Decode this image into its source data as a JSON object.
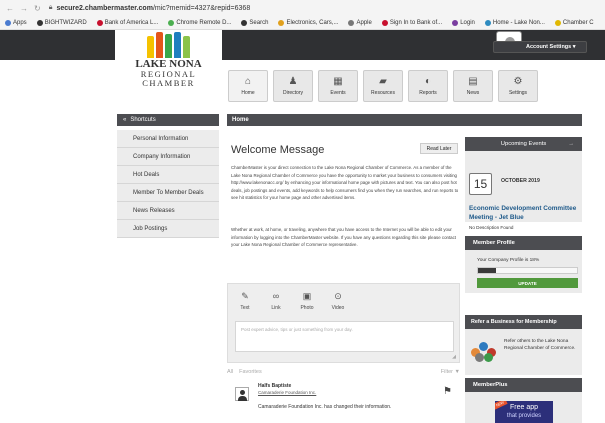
{
  "browser": {
    "url_prefix": "secure2.chambermaster.com",
    "url_path": "/mic?memid=4327&repid=6368"
  },
  "bookmarks": [
    {
      "label": "Apps",
      "color": "#4a7bd0"
    },
    {
      "label": "BIGHTWIZARD",
      "color": "#333333"
    },
    {
      "label": "Bank of America L...",
      "color": "#c8102e"
    },
    {
      "label": "Chrome Remote D...",
      "color": "#4caf50"
    },
    {
      "label": "Search",
      "color": "#333333"
    },
    {
      "label": "Electronics, Cars,...",
      "color": "#e1a01c"
    },
    {
      "label": "Apple",
      "color": "#777777"
    },
    {
      "label": "Sign In to Bank of...",
      "color": "#c8102e"
    },
    {
      "label": "Login",
      "color": "#7a3ea0"
    },
    {
      "label": "Home - Lake Non...",
      "color": "#2e8bc0"
    },
    {
      "label": "Chamber C",
      "color": "#e1b800"
    }
  ],
  "logo": {
    "line1": "LAKE NONA",
    "line2": "REGIONAL",
    "line3": "CHAMBER"
  },
  "account": {
    "label": "Account Settings ▾"
  },
  "nav": [
    {
      "label": "Home",
      "icon": "home-icon",
      "glyph": "⌂"
    },
    {
      "label": "Directory",
      "icon": "directory-icon",
      "glyph": "♟"
    },
    {
      "label": "Events",
      "icon": "calendar-icon",
      "glyph": "▦"
    },
    {
      "label": "Resources",
      "icon": "folder-icon",
      "glyph": "▰"
    },
    {
      "label": "Reports",
      "icon": "reports-icon",
      "glyph": "◐"
    },
    {
      "label": "News",
      "icon": "news-icon",
      "glyph": "▤"
    },
    {
      "label": "Settings",
      "icon": "gear-icon",
      "glyph": "⚙"
    }
  ],
  "shortcuts": {
    "title": "Shortcuts",
    "items": [
      "Personal Information",
      "Company Information",
      "Hot Deals",
      "Member To Member Deals",
      "News Releases",
      "Job Postings"
    ]
  },
  "home": {
    "title": "Home"
  },
  "welcome": {
    "title": "Welcome Message",
    "read_later": "Read Later",
    "p1": "ChamberMaster is your direct connection to the Lake Nona Regional Chamber of Commerce. As a member of the Lake Nona Regional Chamber of Commerce you have the opportunity to market your business to consumers visiting http://www.lakenonacc.org/ by enhancing your informational home page with pictures and text. You can also post hot deals, job postings and events, add keywords to help consumers find you when they run searches, and run reports to see hit statistics for your home page and other advertised items.",
    "p2": "Whether at work, at home, or traveling, anywhere that you have access to the Internet you will be able to edit your information by logging into the ChamberMaster website. If you have any questions regarding this site please contact your Lake Nona Regional Chamber of Commerce representative."
  },
  "post": {
    "options": [
      {
        "label": "Text",
        "icon": "pencil-icon",
        "glyph": "✎"
      },
      {
        "label": "Link",
        "icon": "link-icon",
        "glyph": "∞"
      },
      {
        "label": "Photo",
        "icon": "photo-icon",
        "glyph": "▣"
      },
      {
        "label": "Video",
        "icon": "video-icon",
        "glyph": "⊙"
      }
    ],
    "placeholder": "Post expert advice, tips or just something from your day."
  },
  "feed_tabs": {
    "all": "All",
    "favorites": "Favorites",
    "filter": "Filter ▼"
  },
  "feed": {
    "name": "Halfs Baptiste",
    "org": "Camaraderie Foundation Inc.",
    "message": "Camaraderie Foundation Inc. has changed their information."
  },
  "upcoming": {
    "title": "Upcoming Events",
    "arrow": "→",
    "day": "15",
    "month": "OCTOBER 2019",
    "event": "Economic Development Committee Meeting - Jet Blue",
    "desc": "No Description Found"
  },
  "profile": {
    "title": "Member Profile",
    "pct_label": "Your Company Profile is 18%",
    "pct": 0.18,
    "update": "UPDATE"
  },
  "referral": {
    "title": "Refer a Business for Membership",
    "text": "Refer others to the Lake Nona Regional Chamber of Commerce."
  },
  "memberplus": {
    "title": "MemberPlus",
    "promo1": "Free app",
    "promo2": "that provides",
    "tag": "NEW"
  },
  "colors": {
    "dark_bar": "#4c4d51",
    "update_green": "#51993c",
    "event_blue": "#1f5a8a"
  }
}
